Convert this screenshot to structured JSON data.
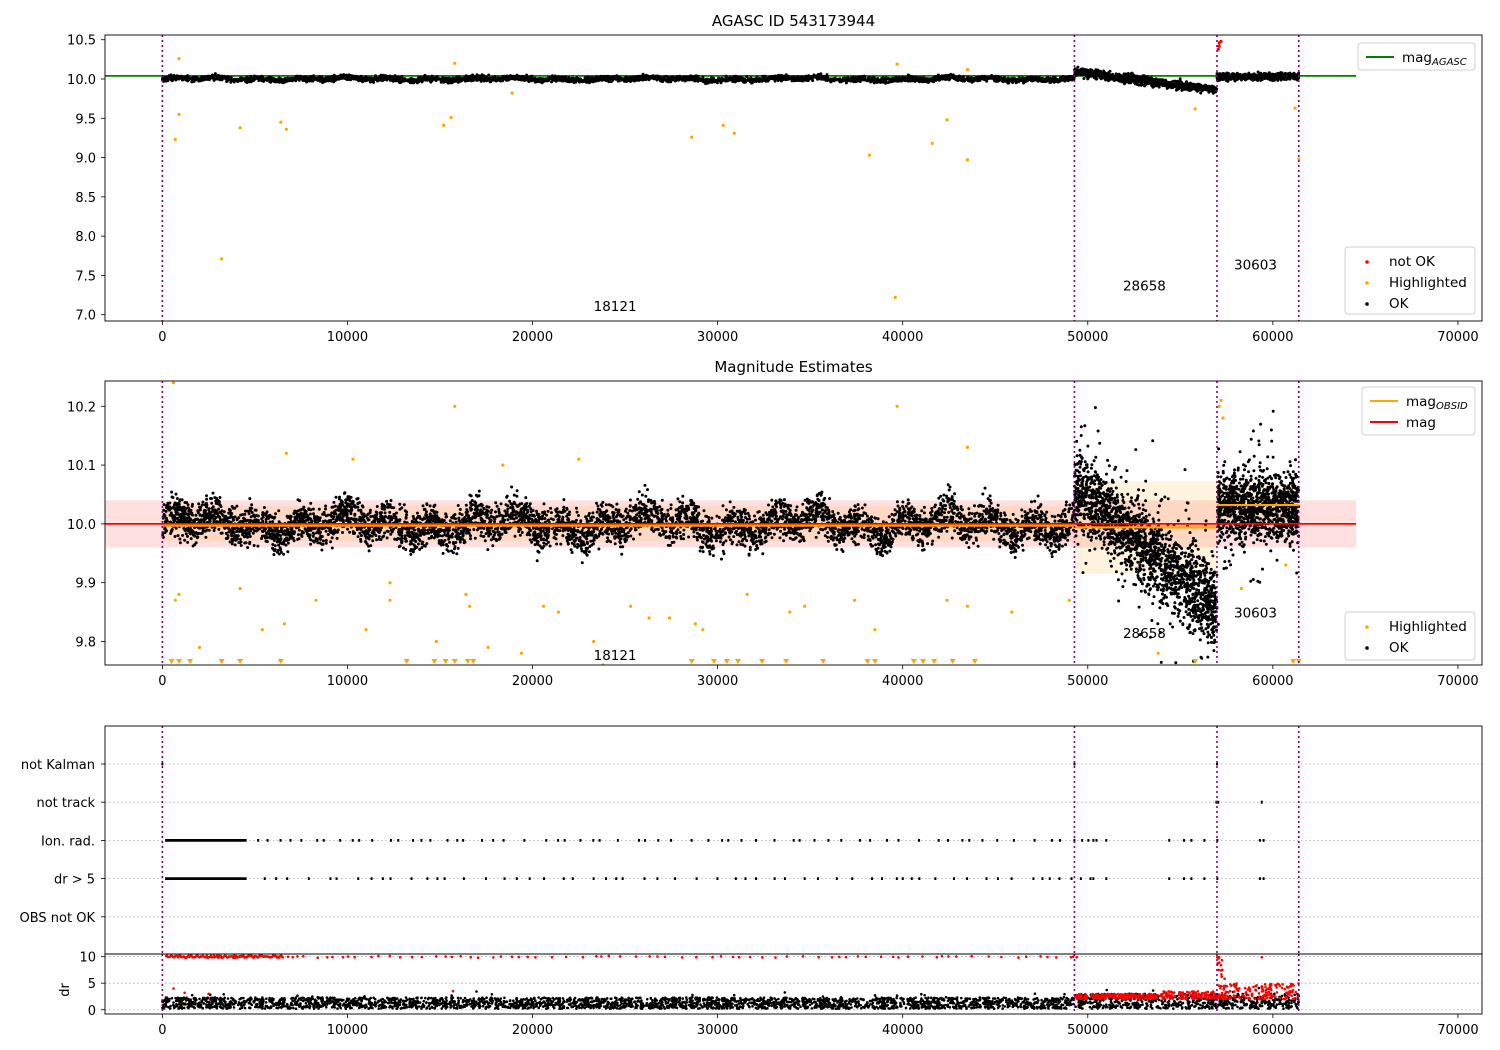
{
  "figure": {
    "vlines": [
      0,
      49280,
      56980,
      61400
    ],
    "xticks": [
      0,
      10000,
      20000,
      30000,
      40000,
      50000,
      60000,
      70000
    ],
    "xlim": [
      -3100,
      71300
    ]
  },
  "chart_data": [
    {
      "type": "scatter",
      "title": "AGASC ID 543173944",
      "xlabel": "",
      "ylabel": "",
      "ylim": [
        6.92,
        10.56
      ],
      "yticks": [
        "10.5",
        "10.0",
        "9.5",
        "9.0",
        "8.5",
        "8.0",
        "7.5",
        "7.0"
      ],
      "legend": {
        "placement": "top-right",
        "entries": [
          {
            "label": "mag",
            "sub": "AGASC",
            "color": "#008000",
            "kind": "line"
          }
        ]
      },
      "legend2": {
        "placement": "bottom-right",
        "entries": [
          {
            "label": "not OK",
            "color": "#ff0000",
            "kind": "dot"
          },
          {
            "label": "Highlighted",
            "color": "#ffa500",
            "kind": "dot"
          },
          {
            "label": "OK",
            "color": "#000000",
            "kind": "dot"
          }
        ]
      },
      "hline": {
        "y": 10.04,
        "color": "#008000",
        "x_range": [
          -3100,
          64500
        ]
      },
      "annotations": [
        {
          "text": "18121",
          "x": 23300,
          "y": 7.02
        },
        {
          "text": "28658",
          "x": 51900,
          "y": 7.28
        },
        {
          "text": "30603",
          "x": 57900,
          "y": 7.55
        }
      ],
      "segments": [
        {
          "obsid": "18121",
          "x_range": [
            0,
            49280
          ],
          "mean": 10.0,
          "spread": 0.03
        },
        {
          "obsid": "28658",
          "x_range": [
            49280,
            56980
          ],
          "mean": [
            10.09,
            9.86
          ],
          "spread": 0.05
        },
        {
          "obsid": "30603",
          "x_range": [
            56980,
            61400
          ],
          "mean": 10.03,
          "spread": 0.04
        }
      ],
      "highlighted": [
        [
          700,
          9.23
        ],
        [
          900,
          9.55
        ],
        [
          3200,
          7.71
        ],
        [
          4200,
          9.38
        ],
        [
          6400,
          9.45
        ],
        [
          6700,
          9.36
        ],
        [
          15200,
          9.41
        ],
        [
          15600,
          9.51
        ],
        [
          18900,
          9.82
        ],
        [
          28600,
          9.26
        ],
        [
          30300,
          9.41
        ],
        [
          30900,
          9.31
        ],
        [
          38200,
          9.03
        ],
        [
          39600,
          7.22
        ],
        [
          41600,
          9.18
        ],
        [
          42400,
          9.48
        ],
        [
          43500,
          8.97
        ],
        [
          55800,
          9.62
        ],
        [
          61200,
          9.63
        ],
        [
          61400,
          8.98
        ],
        [
          900,
          10.26
        ],
        [
          15800,
          10.2
        ],
        [
          39700,
          10.19
        ],
        [
          43500,
          10.12
        ]
      ],
      "not_ok": [
        [
          57100,
          10.46
        ],
        [
          57100,
          10.42
        ],
        [
          57200,
          10.48
        ],
        [
          57050,
          10.38
        ]
      ]
    },
    {
      "type": "scatter",
      "title": "Magnitude Estimates",
      "xlabel": "",
      "ylabel": "",
      "ylim": [
        9.76,
        10.243
      ],
      "yticks": [
        "10.2",
        "10.1",
        "10.0",
        "9.9",
        "9.8"
      ],
      "legend": {
        "placement": "top-right",
        "entries": [
          {
            "label": "mag",
            "sub": "OBSID",
            "color": "#ffa500",
            "kind": "line"
          },
          {
            "label": "mag",
            "sub": "",
            "color": "#ff0000",
            "kind": "line"
          }
        ]
      },
      "legend2": {
        "placement": "bottom-right",
        "entries": [
          {
            "label": "Highlighted",
            "color": "#ffa500",
            "kind": "dot"
          },
          {
            "label": "OK",
            "color": "#000000",
            "kind": "dot"
          }
        ]
      },
      "hline": {
        "y": 10.0,
        "color": "#ff0000",
        "x_range": [
          -3100,
          64500
        ]
      },
      "band": {
        "y_range": [
          9.96,
          10.04
        ],
        "color": "#ff0000",
        "x_range": [
          -3100,
          64500
        ]
      },
      "obsid_mags": [
        {
          "x_range": [
            0,
            49280
          ],
          "mag": 9.997,
          "band": [
            9.97,
            10.03
          ]
        },
        {
          "x_range": [
            49280,
            56980
          ],
          "mag": 9.994,
          "band": [
            9.915,
            10.072
          ]
        },
        {
          "x_range": [
            56980,
            61400
          ],
          "mag": 10.032,
          "band": [
            10.0,
            10.07
          ]
        }
      ],
      "annotations": [
        {
          "text": "18121",
          "x": 23300,
          "y": 9.775
        },
        {
          "text": "28658",
          "x": 51900,
          "y": 9.813
        },
        {
          "text": "30603",
          "x": 57900,
          "y": 9.848
        }
      ],
      "segments": [
        {
          "obsid": "18121",
          "x_range": [
            0,
            49280
          ],
          "mean": 10.0,
          "spread": 0.03
        },
        {
          "obsid": "28658",
          "x_range": [
            49280,
            56980
          ],
          "mean": [
            10.06,
            9.86
          ],
          "spread": 0.06
        },
        {
          "obsid": "30603",
          "x_range": [
            56980,
            61400
          ],
          "mean": 10.03,
          "spread": 0.05
        }
      ],
      "highlighted": [
        [
          600,
          10.24
        ],
        [
          15800,
          10.2
        ],
        [
          39700,
          10.2
        ],
        [
          43500,
          10.13
        ],
        [
          6700,
          10.12
        ],
        [
          10300,
          10.11
        ],
        [
          22500,
          10.11
        ],
        [
          18400,
          10.1
        ],
        [
          700,
          9.87
        ],
        [
          900,
          9.88
        ],
        [
          2000,
          9.79
        ],
        [
          4200,
          9.89
        ],
        [
          5400,
          9.82
        ],
        [
          6600,
          9.83
        ],
        [
          8300,
          9.87
        ],
        [
          11000,
          9.82
        ],
        [
          12300,
          9.87
        ],
        [
          12300,
          9.9
        ],
        [
          14800,
          9.8
        ],
        [
          16400,
          9.88
        ],
        [
          16600,
          9.86
        ],
        [
          17600,
          9.79
        ],
        [
          19400,
          9.78
        ],
        [
          20600,
          9.86
        ],
        [
          21400,
          9.85
        ],
        [
          23300,
          9.8
        ],
        [
          23800,
          9.76
        ],
        [
          25300,
          9.86
        ],
        [
          26300,
          9.84
        ],
        [
          27400,
          9.84
        ],
        [
          28800,
          9.83
        ],
        [
          29200,
          9.82
        ],
        [
          31600,
          9.88
        ],
        [
          33900,
          9.85
        ],
        [
          34700,
          9.86
        ],
        [
          37400,
          9.87
        ],
        [
          38500,
          9.82
        ],
        [
          42400,
          9.87
        ],
        [
          43500,
          9.86
        ],
        [
          45900,
          9.85
        ],
        [
          49000,
          9.87
        ],
        [
          53800,
          9.78
        ],
        [
          58300,
          9.89
        ],
        [
          60700,
          9.93
        ],
        [
          57100,
          10.2
        ],
        [
          57300,
          10.18
        ],
        [
          57200,
          10.21
        ]
      ],
      "clipped_low": [
        500,
        900,
        1500,
        3200,
        4200,
        6400,
        13200,
        14700,
        15300,
        15800,
        16500,
        16800,
        28600,
        29800,
        30500,
        31100,
        32400,
        33700,
        35700,
        38100,
        38500,
        40600,
        41100,
        41700,
        42700,
        43900
      ],
      "clipped_low_right": [
        55800,
        61100,
        61400
      ]
    },
    {
      "type": "scatter",
      "title": "",
      "xlabel": "",
      "ylabel": "",
      "categories": [
        "not Kalman",
        "not track",
        "Ion. rad.",
        "dr > 5",
        "OBS not OK"
      ],
      "flags": {
        "not Kalman": [
          0,
          49280,
          56980
        ],
        "not track": [
          56950,
          57050,
          59400
        ],
        "Ion. rad.": "dense 0-4500, sparse 4500-59500",
        "dr > 5": "dense 0-4500, sparse 4500-59500",
        "OBS not OK": []
      }
    },
    {
      "type": "scatter",
      "title": "",
      "xlabel": "",
      "ylabel": "dr",
      "ylim": [
        -0.8,
        10.5
      ],
      "yticks": [
        "10",
        "5",
        "0"
      ],
      "ok_band": [
        0.2,
        2.6
      ],
      "not_ok": "points at dr = 10 (clipped), dense 0-6500, sparse up to 59500; scattered 2-5 in 49280-61400"
    }
  ]
}
